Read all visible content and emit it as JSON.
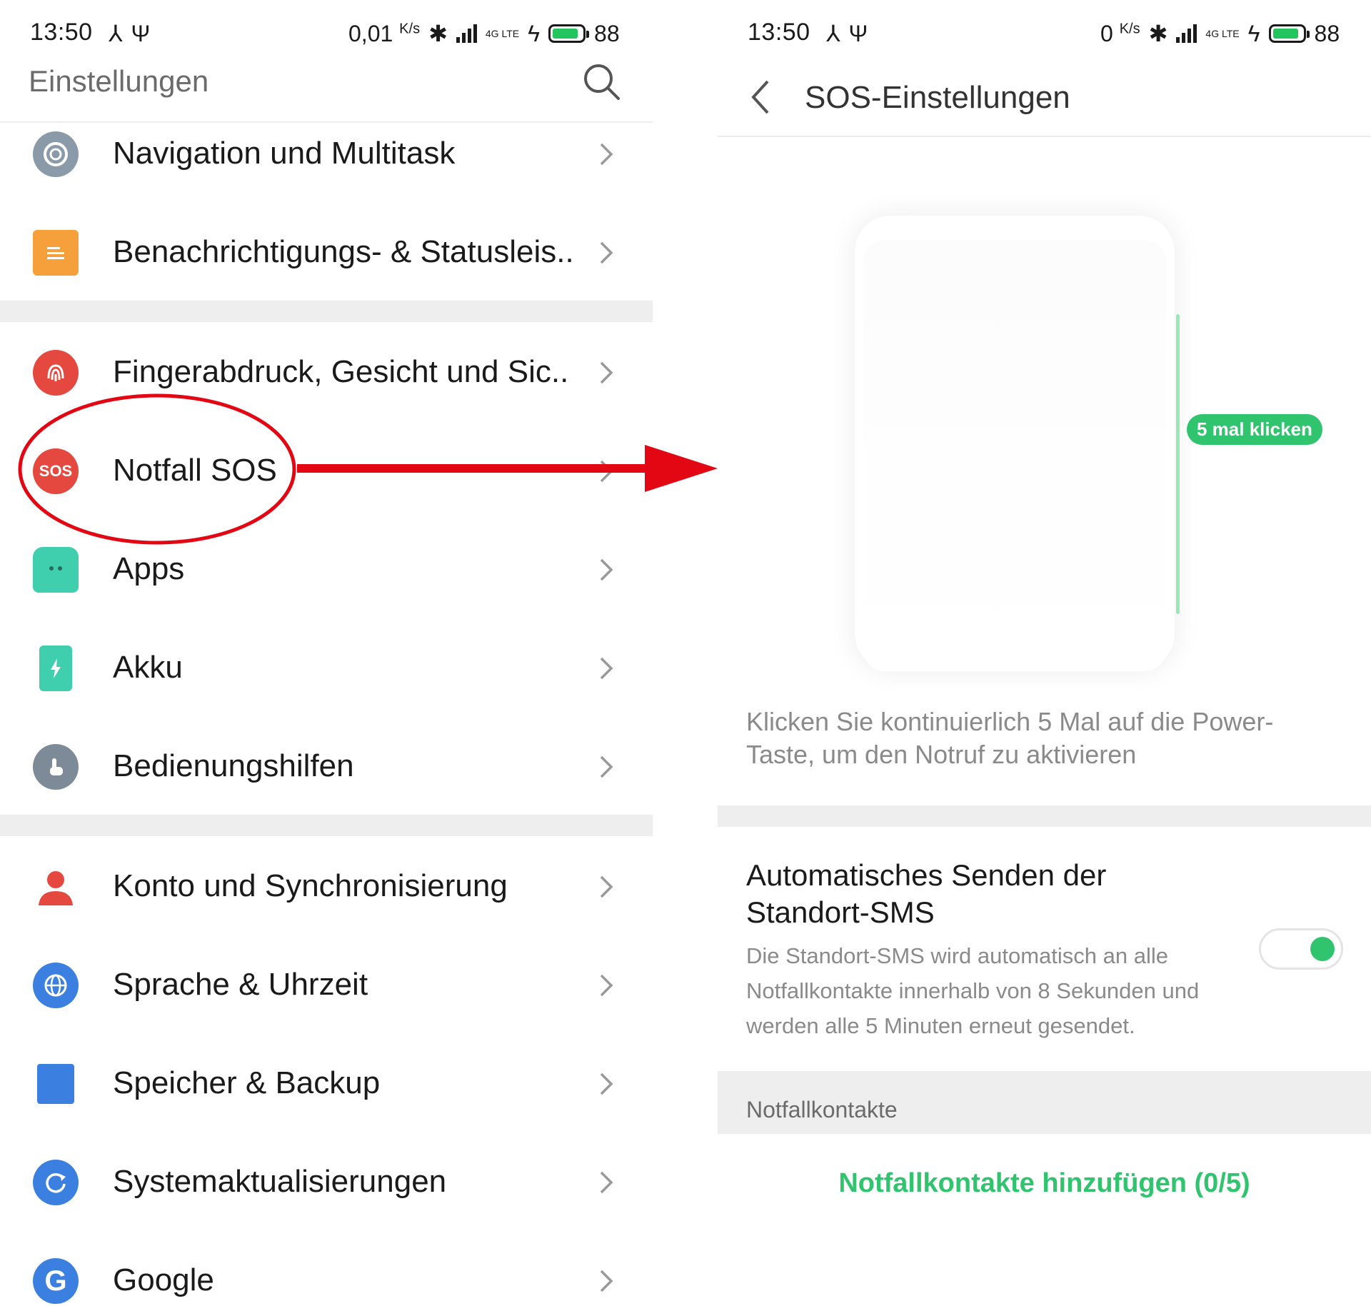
{
  "left": {
    "status": {
      "time": "13:50",
      "speed": "0,01",
      "speed_unit": "K/s",
      "battery": "88",
      "network": "4G LTE"
    },
    "header": {
      "title": "Einstellungen"
    },
    "items": [
      {
        "label": "Navigation und Multitask",
        "icon": "navigation-icon",
        "color": "#8a9aa8"
      },
      {
        "label": "Benachrichtigungs- & Statusleis..",
        "icon": "notification-icon",
        "color": "#f5a03a"
      },
      {
        "label": "Fingerabdruck, Gesicht und Sic..",
        "icon": "fingerprint-icon",
        "color": "#e5483f"
      },
      {
        "label": "Notfall SOS",
        "icon": "sos-icon",
        "icon_text": "SOS",
        "color": "#e5483f"
      },
      {
        "label": "Apps",
        "icon": "android-icon",
        "color": "#3fcfae"
      },
      {
        "label": "Akku",
        "icon": "battery-icon",
        "color": "#3fcfae"
      },
      {
        "label": "Bedienungshilfen",
        "icon": "accessibility-icon",
        "color": "#7d8a97"
      },
      {
        "label": "Konto und Synchronisierung",
        "icon": "account-icon",
        "color": "#e5483f"
      },
      {
        "label": "Sprache & Uhrzeit",
        "icon": "globe-icon",
        "color": "#3b7fe0"
      },
      {
        "label": "Speicher & Backup",
        "icon": "storage-icon",
        "color": "#3b7fe0"
      },
      {
        "label": "Systemaktualisierungen",
        "icon": "update-icon",
        "color": "#3b7fe0"
      },
      {
        "label": "Google",
        "icon": "google-icon",
        "icon_text": "G",
        "color": "#3b7fe0"
      }
    ]
  },
  "right": {
    "status": {
      "time": "13:50",
      "speed": "0",
      "speed_unit": "K/s",
      "battery": "88",
      "network": "4G LTE"
    },
    "header": {
      "title": "SOS-Einstellungen"
    },
    "illustration": {
      "pill": "5 mal klicken"
    },
    "description": "Klicken Sie kontinuierlich 5 Mal auf die Power-Taste, um den Notruf zu aktivieren",
    "auto_sms": {
      "title": "Automatisches Senden der Standort-SMS",
      "description": "Die Standort-SMS wird automatisch an alle Notfallkontakte innerhalb von 8 Sekunden und werden alle 5 Minuten erneut gesendet.",
      "enabled": true
    },
    "contacts_section": "Notfallkontakte",
    "add_contacts": "Notfallkontakte hinzufügen (0/5)"
  },
  "annotation": {
    "color": "#e30613"
  },
  "colors": {
    "accent_green": "#31c46e",
    "text_gray": "#8a8a8a",
    "divider": "#eeeeee"
  }
}
